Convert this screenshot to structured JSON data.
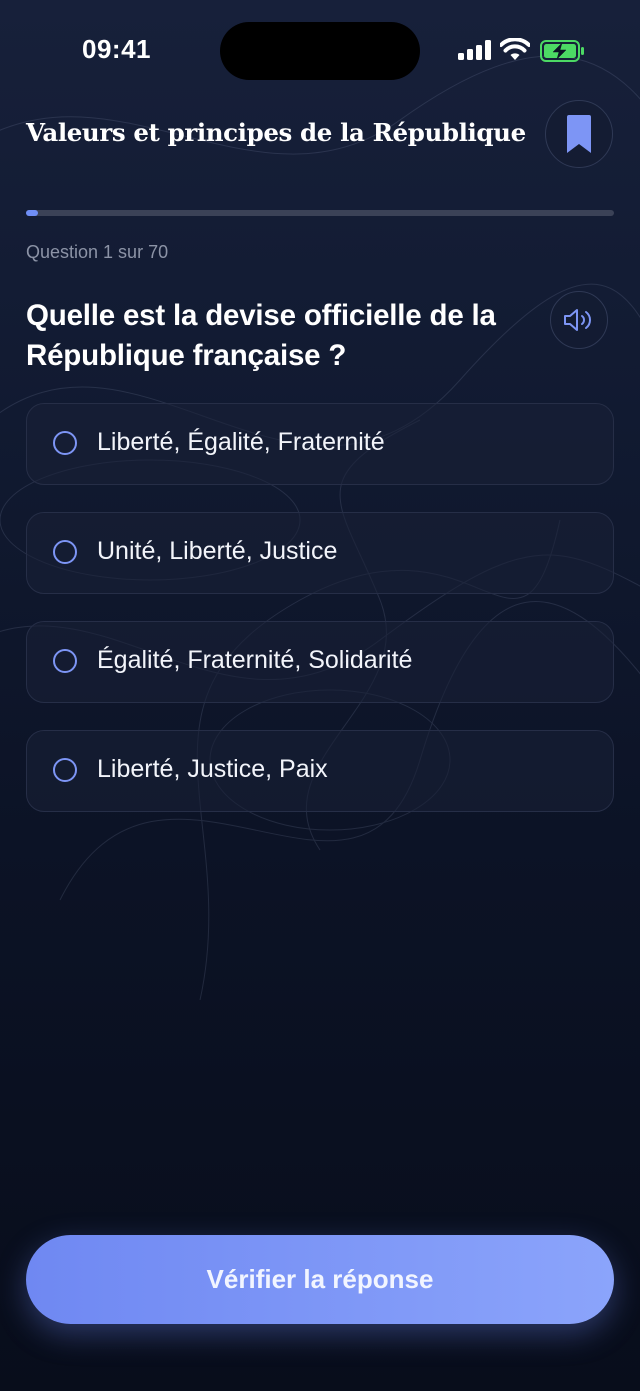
{
  "status_bar": {
    "time": "09:41"
  },
  "header": {
    "title": "Valeurs et principes de la République"
  },
  "progress": {
    "fraction": 0.02,
    "counter": "Question 1 sur 70"
  },
  "question": {
    "text": "Quelle est la devise officielle de la République française ?"
  },
  "options": [
    {
      "label": "Liberté, Égalité, Fraternité"
    },
    {
      "label": "Unité, Liberté, Justice"
    },
    {
      "label": "Égalité, Fraternité, Solidarité"
    },
    {
      "label": "Liberté, Justice, Paix"
    }
  ],
  "cta": {
    "label": "Vérifier la réponse"
  },
  "colors": {
    "accent": "#7d95f5",
    "background": "#0c1326",
    "battery": "#4cd964"
  },
  "icons": {
    "bookmark": "bookmark-icon",
    "speaker": "speaker-icon",
    "radio": "radio-circle-icon"
  }
}
